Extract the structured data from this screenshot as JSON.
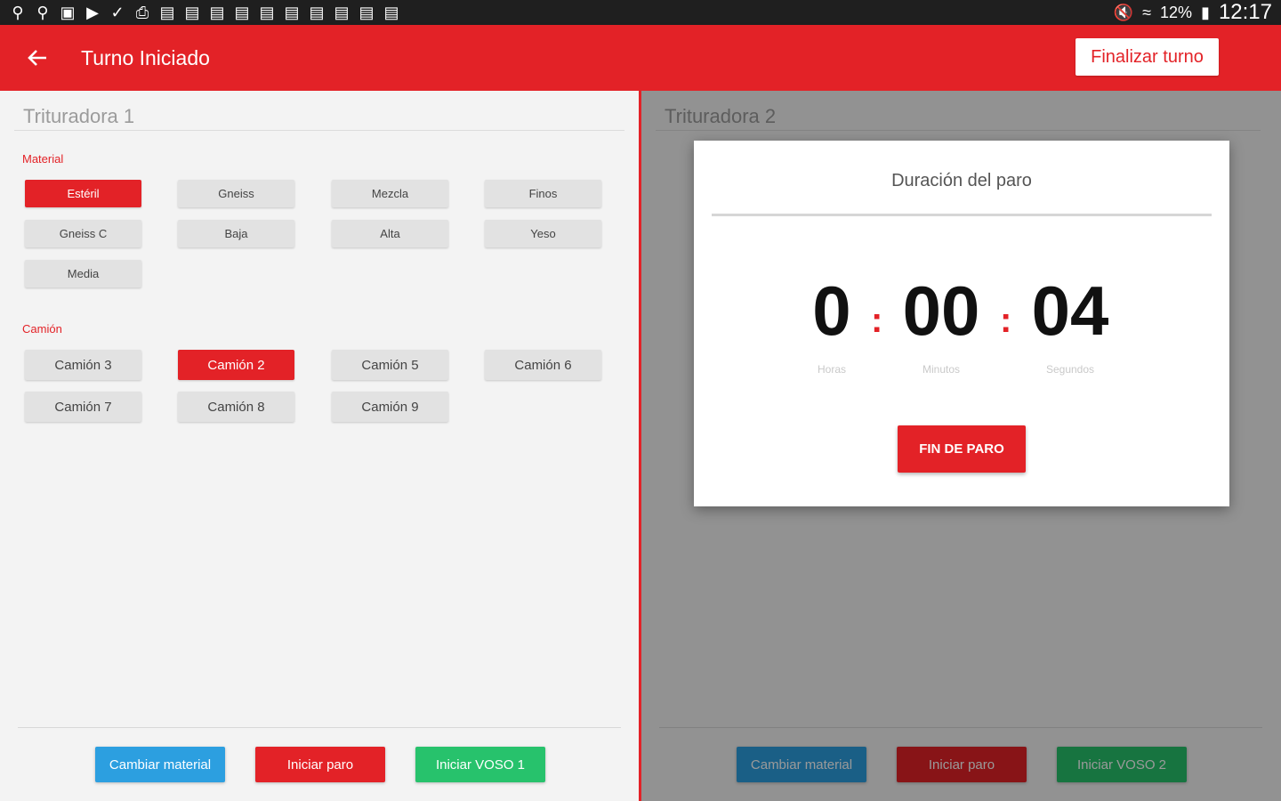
{
  "status_bar": {
    "left_icons": [
      "location-icon",
      "location-icon",
      "image-icon",
      "youtube-icon",
      "download-done-icon",
      "print-icon",
      "train-icon",
      "train-icon",
      "train-icon",
      "train-icon",
      "train-icon",
      "train-icon",
      "train-icon",
      "train-icon",
      "train-icon",
      "train-icon"
    ],
    "battery": "12%",
    "time": "12:17"
  },
  "app_bar": {
    "title": "Turno Iniciado",
    "finalizar_label": "Finalizar turno",
    "color": "#e32227"
  },
  "left_panel": {
    "title": "Trituradora 1",
    "material_label": "Material",
    "materials": [
      "Estéril",
      "Gneiss",
      "Mezcla",
      "Finos",
      "Gneiss C",
      "Baja",
      "Alta",
      "Yeso",
      "Media"
    ],
    "camion_label": "Camión",
    "camiones": [
      "Camión 3",
      "Camión 2",
      "Camión 5",
      "Camión 6",
      "Camión 7",
      "Camión 8",
      "Camión 9"
    ],
    "actions": {
      "cambiar": "Cambiar material",
      "iniciar_paro": "Iniciar paro",
      "iniciar_voso": "Iniciar VOSO 1"
    }
  },
  "right_panel": {
    "title": "Trituradora 2",
    "actions": {
      "cambiar": "Cambiar material",
      "iniciar_paro": "Iniciar paro",
      "iniciar_voso": "Iniciar VOSO 2"
    }
  },
  "dialog": {
    "title": "Duración del paro",
    "hours": "0",
    "minutes": "00",
    "seconds": "04",
    "separator": ":",
    "hours_label": "Horas",
    "minutes_label": "Minutos",
    "seconds_label": "Segundos",
    "fin_label": "FIN DE PARO"
  }
}
